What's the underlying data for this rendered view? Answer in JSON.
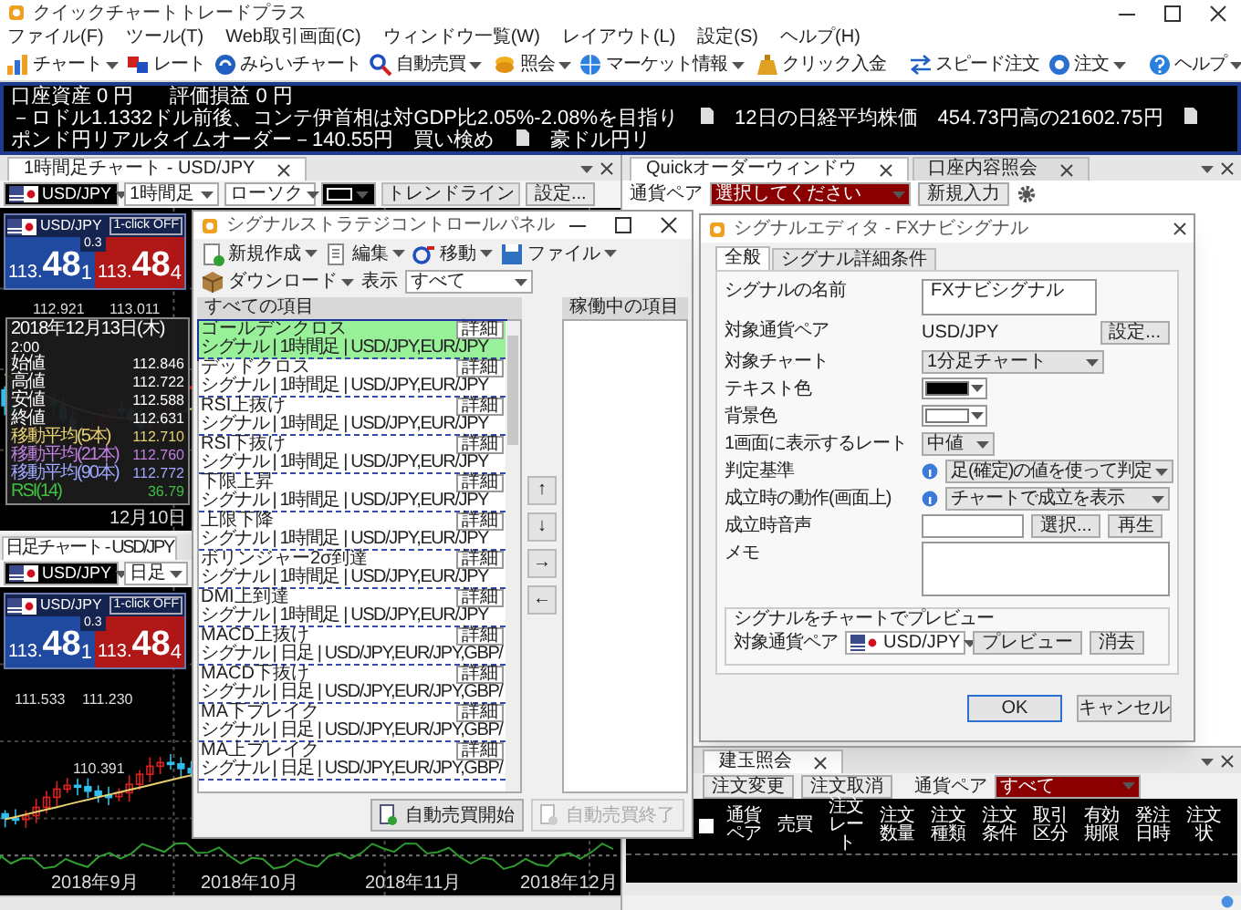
{
  "window": {
    "title": "クイックチャートトレードプラス"
  },
  "menu": [
    "ファイル(F)",
    "ツール(T)",
    "Web取引画面(C)",
    "ウィンドウ一覧(W)",
    "レイアウト(L)",
    "設定(S)",
    "ヘルプ(H)"
  ],
  "toolbar": [
    {
      "kind": "chart",
      "label": "チャート",
      "dropdown": true
    },
    {
      "kind": "rate",
      "label": "レート",
      "dropdown": false
    },
    {
      "kind": "future",
      "label": "みらいチャート",
      "dropdown": false
    },
    {
      "kind": "auto",
      "label": "自動売買",
      "dropdown": true
    },
    {
      "kind": "inquiry",
      "label": "照会",
      "dropdown": true
    },
    {
      "kind": "market",
      "label": "マーケット情報",
      "dropdown": true
    },
    {
      "kind": "deposit",
      "label": "クリック入金",
      "dropdown": false
    },
    {
      "kind": "speed",
      "label": "スピード注文",
      "dropdown": false
    },
    {
      "kind": "order",
      "label": "注文",
      "dropdown": true
    },
    {
      "kind": "help",
      "label": "ヘルプ",
      "dropdown": true
    }
  ],
  "account": [
    "口座資産 0 円",
    "評価損益 0 円"
  ],
  "news": [
    "－ロドル1.1332ドル前後、コンテ伊首相は対GDP比2.05%-2.08%を目指り",
    "12日の日経平均株価　454.73円高の21602.75円",
    "ポンド円リアルタイムオーダー－140.55円　買い検め",
    "豪ドル円リ"
  ],
  "charts": [
    {
      "tab": "1時間足チャート - USD/JPY",
      "pair": "USD/JPY",
      "timeframe": "1時間足",
      "style": "ローソク",
      "tool": "トレンドライン",
      "settings": "設定...",
      "quote": {
        "pair": "USD/JPY",
        "mode": "1-click OFF",
        "bid": [
          "113.",
          "48",
          "1"
        ],
        "ask": [
          "113.",
          "48",
          "4"
        ],
        "spread": "0.3"
      },
      "labels": [
        "112.921",
        "113.011"
      ],
      "x_labels": [
        "12月10日"
      ],
      "tooltip": {
        "title": "2018年12月13日(木)",
        "time": "2:00",
        "rows": [
          {
            "label": "始値",
            "value": "112.846",
            "color": "#ffffff"
          },
          {
            "label": "高値",
            "value": "112.722",
            "color": "#ffffff"
          },
          {
            "label": "安値",
            "value": "112.588",
            "color": "#ffffff"
          },
          {
            "label": "終値",
            "value": "112.631",
            "color": "#ffffff"
          },
          {
            "label": "移動平均(5本)",
            "value": "112.710",
            "color": "#e8d070"
          },
          {
            "label": "移動平均(21本)",
            "value": "112.760",
            "color": "#c080e0"
          },
          {
            "label": "移動平均(90本)",
            "value": "112.772",
            "color": "#a0a8ff"
          },
          {
            "label": "RSI(14)",
            "value": "36.79",
            "color": "#40c040"
          }
        ]
      }
    },
    {
      "tab": "日足チャート - USD/JPY",
      "pair": "USD/JPY",
      "timeframe": "日足",
      "quote": {
        "pair": "USD/JPY",
        "mode": "1-click OFF",
        "bid": [
          "113.",
          "48",
          "1"
        ],
        "ask": [
          "113.",
          "48",
          "4"
        ],
        "spread": "0.3"
      },
      "labels": [
        "111.533",
        "111.230",
        "110.391"
      ],
      "x_labels": [
        "2018年9月",
        "2018年10月",
        "2018年11月",
        "2018年12月"
      ]
    }
  ],
  "order_window": {
    "tabs": [
      {
        "label": "Quickオーダーウィンドウ",
        "selected": true
      },
      {
        "label": "口座内容照会",
        "selected": false
      }
    ],
    "pair_label": "通貨ペア",
    "pair": "選択してください",
    "new_button": "新規入力"
  },
  "orders_panel": {
    "tabs": [
      {
        "label": "建玉照会",
        "selected": true
      }
    ],
    "select_all": {
      "checked": false
    },
    "buttons": [
      "注文変更",
      "注文取消"
    ],
    "pair_label": "通貨ペア",
    "pair": "すべて",
    "columns": [
      "通貨ペア",
      "売買",
      "注文レート",
      "注文数量",
      "注文種類",
      "注文条件",
      "取引区分",
      "有効期限",
      "発注日時",
      "注文状"
    ]
  },
  "strategy_panel": {
    "title": "シグナルストラテジコントロールパネル",
    "toolbar": [
      {
        "kind": "new",
        "label": "新規作成"
      },
      {
        "kind": "edit",
        "label": "編集"
      },
      {
        "kind": "move",
        "label": "移動"
      },
      {
        "kind": "file",
        "label": "ファイル"
      },
      {
        "kind": "download",
        "label": "ダウンロード"
      }
    ],
    "view_label": "表示",
    "view": "すべて",
    "all_header": "すべての項目",
    "active_header": "稼働中の項目",
    "items": [
      {
        "name": "ゴールデンクロス",
        "detail": "シグナル | 1時間足 | USD/JPY,EUR/JPY",
        "button": "詳細",
        "selected": true
      },
      {
        "name": "デッドクロス",
        "detail": "シグナル | 1時間足 | USD/JPY,EUR/JPY",
        "button": "詳細",
        "selected": false
      },
      {
        "name": "RSI上抜け",
        "detail": "シグナル | 1時間足 | USD/JPY,EUR/JPY",
        "button": "詳細",
        "selected": false
      },
      {
        "name": "RSI下抜け",
        "detail": "シグナル | 1時間足 | USD/JPY,EUR/JPY",
        "button": "詳細",
        "selected": false
      },
      {
        "name": "下限上昇",
        "detail": "シグナル | 1時間足 | USD/JPY,EUR/JPY",
        "button": "詳細",
        "selected": false
      },
      {
        "name": "上限下降",
        "detail": "シグナル | 1時間足 | USD/JPY,EUR/JPY",
        "button": "詳細",
        "selected": false
      },
      {
        "name": "ボリンジャー2σ到達",
        "detail": "シグナル | 1時間足 | USD/JPY,EUR/JPY",
        "button": "詳細",
        "selected": false
      },
      {
        "name": "DMI上到達",
        "detail": "シグナル | 1時間足 | USD/JPY,EUR/JPY",
        "button": "詳細",
        "selected": false
      },
      {
        "name": "MACD上抜け",
        "detail": "シグナル | 日足 | USD/JPY,EUR/JPY,GBP/",
        "button": "詳細",
        "selected": false
      },
      {
        "name": "MACD下抜け",
        "detail": "シグナル | 日足 | USD/JPY,EUR/JPY,GBP/",
        "button": "詳細",
        "selected": false
      },
      {
        "name": "MA下ブレイク",
        "detail": "シグナル | 日足 | USD/JPY,EUR/JPY,GBP/",
        "button": "詳細",
        "selected": false
      },
      {
        "name": "MA上ブレイク",
        "detail": "シグナル | 日足 | USD/JPY,EUR/JPY,GBP/",
        "button": "詳細",
        "selected": false
      }
    ],
    "arrows": [
      "↑",
      "↓",
      "→",
      "←"
    ],
    "start": {
      "label": "自動売買開始",
      "disabled": false
    },
    "stop": {
      "label": "自動売買終了",
      "disabled": true
    }
  },
  "signal_editor": {
    "title": "シグナルエディタ - FXナビシグナル",
    "tabs": [
      {
        "label": "全般",
        "selected": true
      },
      {
        "label": "シグナル詳細条件",
        "selected": false
      }
    ],
    "fields": [
      {
        "kind": "textarea",
        "label": "シグナルの名前",
        "value": "FXナビシグナル"
      },
      {
        "kind": "text_button",
        "label": "対象通貨ペア",
        "value": "USD/JPY",
        "button": "設定..."
      },
      {
        "kind": "select",
        "label": "対象チャート",
        "value": "1分足チャート"
      },
      {
        "kind": "color",
        "label": "テキスト色",
        "color": "#000000"
      },
      {
        "kind": "color",
        "label": "背景色",
        "color": "#ffffff"
      },
      {
        "kind": "select_small",
        "label": "1画面に表示するレート",
        "value": "中値"
      },
      {
        "kind": "select_info",
        "label": "判定基準",
        "value": "足(確定)の値を使って判定"
      },
      {
        "kind": "select_info",
        "label": "成立時の動作(画面上)",
        "value": "チャートで成立を表示"
      },
      {
        "kind": "sound",
        "label": "成立時音声",
        "buttons": [
          "選択...",
          "再生"
        ]
      },
      {
        "kind": "memo",
        "label": "メモ"
      }
    ],
    "preview": {
      "title": "シグナルをチャートでプレビュー",
      "label": "対象通貨ペア",
      "pair": "USD/JPY",
      "buttons": [
        "プレビュー",
        "消去"
      ]
    },
    "buttons": [
      "OK",
      "キャンセル"
    ]
  }
}
